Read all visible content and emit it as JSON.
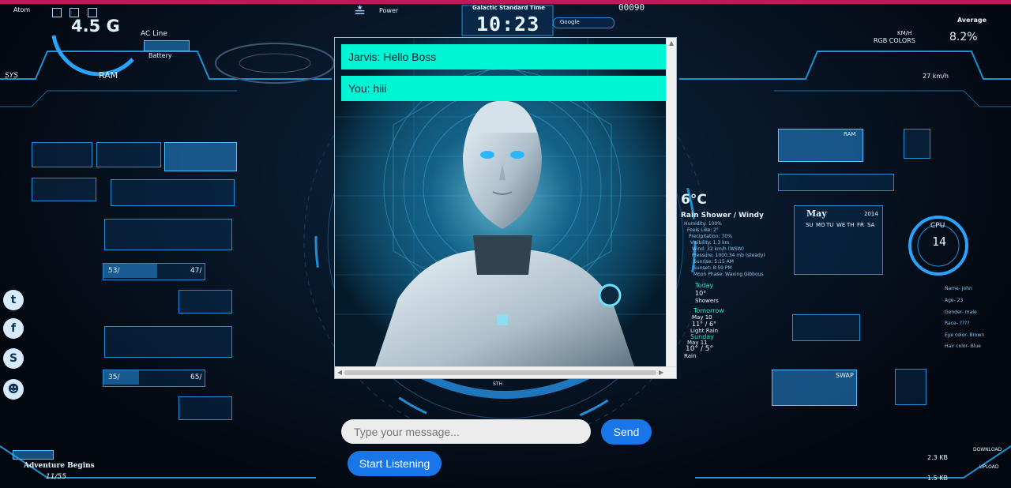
{
  "hud": {
    "atom": "Atom",
    "ram_value": "4.5 G",
    "ram_label": "RAM",
    "ac_line": "AC Line",
    "battery": "Battery",
    "sys": "SYS",
    "power": "Power",
    "galactic_time_label": "Galactic Standard Time",
    "clock": "10:23",
    "google": "Google",
    "counter": "00090",
    "average": "Average",
    "average_value": "8.2%",
    "rgb_colors": "RGB COLORS",
    "kmh": "KM/H",
    "wind_speed": "27 km/h",
    "cpu_label": "CPU",
    "cpu_value": "14",
    "temperature": "6°C",
    "weather_title": "Rain Shower / Windy",
    "weather_details": [
      "Humidity: 100%",
      "Feels Like: 2°",
      "Precipitation: 70%",
      "Visibility: 1.3 km",
      "Wind: 32 km/h (WSW)",
      "Pressure: 1000.34 mb (steady)",
      "Sunrise: 5:15 AM",
      "Sunset: 8:59 PM",
      "Moon Phase: Waxing Gibbous"
    ],
    "today": "Today",
    "today_temp": "10°",
    "today_cond": "Showers",
    "tomorrow": "Tomorrow",
    "tomorrow_date": "May 10",
    "tomorrow_temp": "11° / 6°",
    "tomorrow_cond": "Light Rain",
    "sunday": "Sunday",
    "sunday_date": "May 11",
    "sunday_temp": "10° / 5°",
    "sunday_cond": "Rain",
    "calendar_month": "May",
    "calendar_year": "2014",
    "calendar_days": [
      "SU",
      "MO",
      "TU",
      "WE",
      "TH",
      "FR",
      "SA"
    ],
    "profile": [
      "Name- John",
      "Age- 23",
      "Gender- male",
      "Race- ????",
      "Eye color- Brown",
      "Hair color- Blue"
    ],
    "disk1_percent": "53/",
    "disk1_percent_right": "47/",
    "disk2_percent": "35/",
    "disk2_percent_right": "65/",
    "adventure": "Adventure Begins",
    "adventure_date": "11/55",
    "download": "DOWNLOAD",
    "upload": "UPLOAD",
    "download_rate": "2.3 KB",
    "upload_rate": "1.5 KB",
    "sth": "STH",
    "swap": "SWAP",
    "ram_right": "RAM"
  },
  "chat": {
    "messages": [
      {
        "text": "Jarvis: Hello Boss"
      },
      {
        "text": "You: hiii"
      }
    ],
    "input_placeholder": "Type your message...",
    "send_label": "Send",
    "listen_label": "Start Listening"
  },
  "colors": {
    "message_bg": "#00f5d4",
    "button_bg": "#1976e8",
    "hud_accent": "#1f8fd6",
    "topline": "#c2185b"
  }
}
